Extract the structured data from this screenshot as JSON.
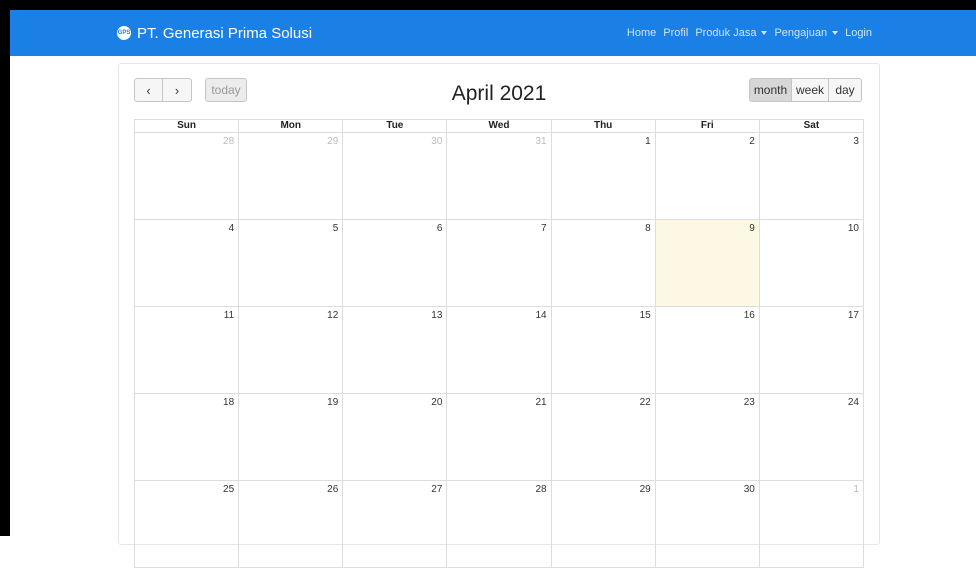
{
  "navbar": {
    "brand_name": "PT. Generasi Prima Solusi",
    "logo_text": "GPS",
    "links": [
      "Home",
      "Profil",
      "Produk Jasa",
      "Pengajuan",
      "Login"
    ],
    "color": "#1a80e6"
  },
  "calendar": {
    "title": "April 2021",
    "today_label": "today",
    "prev_icon": "‹",
    "next_icon": "›",
    "views": [
      "month",
      "week",
      "day"
    ],
    "active_view": "month",
    "weekdays": [
      "Sun",
      "Mon",
      "Tue",
      "Wed",
      "Thu",
      "Fri",
      "Sat"
    ],
    "weeks": [
      [
        "28",
        "29",
        "30",
        "31",
        "1",
        "2",
        "3"
      ],
      [
        "4",
        "5",
        "6",
        "7",
        "8",
        "9",
        "10"
      ],
      [
        "11",
        "12",
        "13",
        "14",
        "15",
        "16",
        "17"
      ],
      [
        "18",
        "19",
        "20",
        "21",
        "22",
        "23",
        "24"
      ],
      [
        "25",
        "26",
        "27",
        "28",
        "29",
        "30",
        "1"
      ]
    ],
    "today_highlight_color": "#fcf8e3"
  }
}
